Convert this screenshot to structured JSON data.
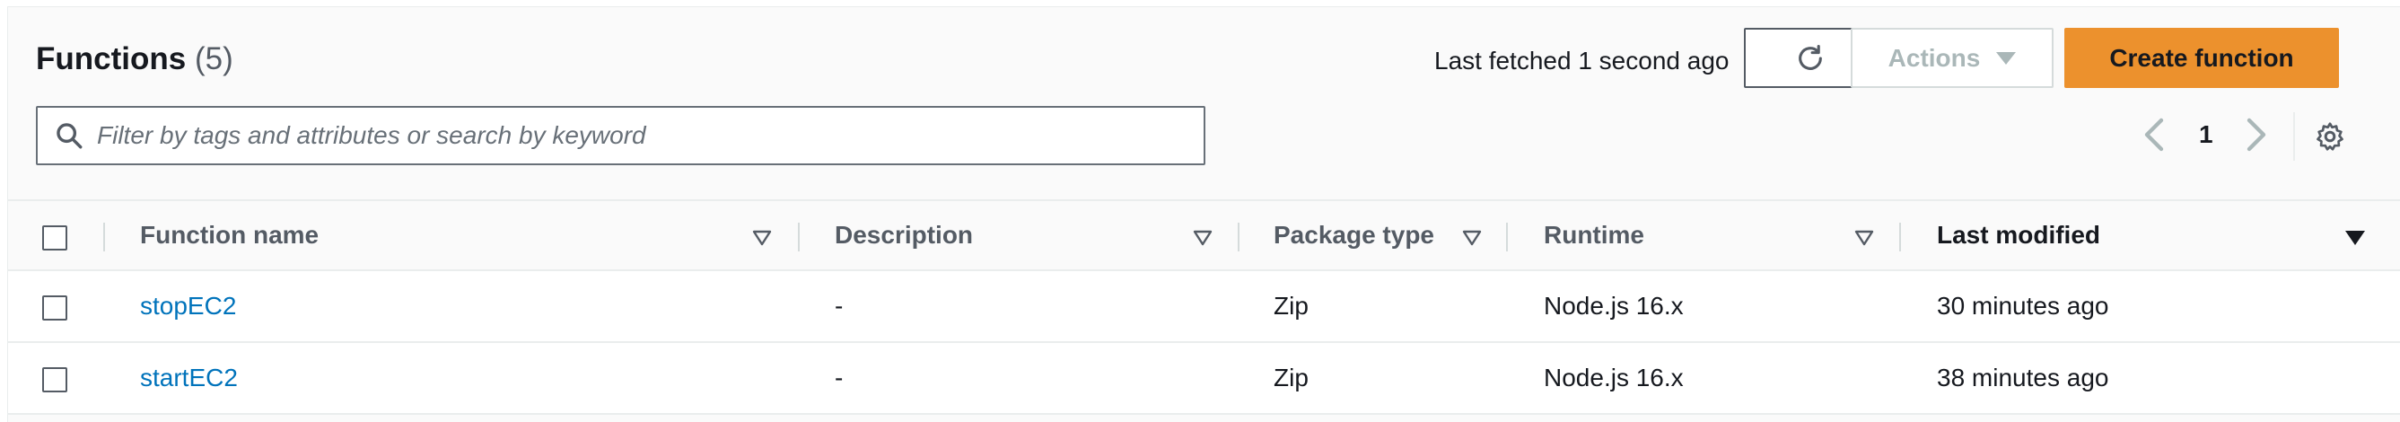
{
  "header": {
    "title": "Functions",
    "count": "(5)",
    "last_fetched": "Last fetched 1 second ago",
    "refresh_icon": "refresh-icon",
    "actions_label": "Actions",
    "create_label": "Create function"
  },
  "search": {
    "placeholder": "Filter by tags and attributes or search by keyword",
    "value": ""
  },
  "pagination": {
    "current_page": "1"
  },
  "table": {
    "columns": [
      {
        "label": "Function name"
      },
      {
        "label": "Description"
      },
      {
        "label": "Package type"
      },
      {
        "label": "Runtime"
      },
      {
        "label": "Last modified"
      }
    ],
    "rows": [
      {
        "name": "stopEC2",
        "description": "-",
        "package_type": "Zip",
        "runtime": "Node.js 16.x",
        "last_modified": "30 minutes ago"
      },
      {
        "name": "startEC2",
        "description": "-",
        "package_type": "Zip",
        "runtime": "Node.js 16.x",
        "last_modified": "38 minutes ago"
      }
    ]
  },
  "colors": {
    "primary_button": "#ec912d",
    "link": "#0073bb",
    "text": "#16191f",
    "secondary_text": "#545b64"
  }
}
